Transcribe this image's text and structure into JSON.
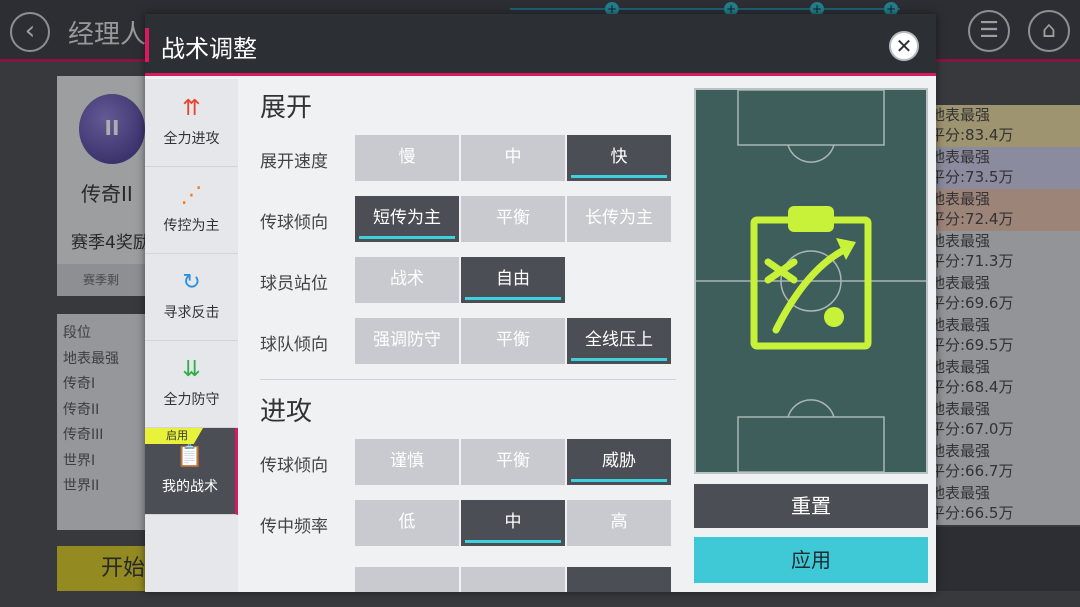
{
  "background": {
    "title": "经理人",
    "rank_name": "传奇II",
    "badge_text": "II",
    "season_text": "赛季4奖励",
    "remain_text": "赛季剩",
    "tier_header": "段位",
    "tiers": [
      "地表最强",
      "传奇I",
      "传奇II",
      "传奇III",
      "世界I",
      "世界II"
    ],
    "start_label": "开始",
    "leaderboard": [
      {
        "name": "地表最强",
        "score": "平分:83.4万",
        "color": "#e8d9a0"
      },
      {
        "name": "地表最强",
        "score": "平分:73.5万",
        "color": "#c9cbe6"
      },
      {
        "name": "地表最强",
        "score": "平分:72.4万",
        "color": "#e6c1ad"
      },
      {
        "name": "地表最强",
        "score": "平分:71.3万",
        "color": "#d8d9dc"
      },
      {
        "name": "地表最强",
        "score": "平分:69.6万",
        "color": "#d8d9dc"
      },
      {
        "name": "地表最强",
        "score": "平分:69.5万",
        "color": "#d8d9dc"
      },
      {
        "name": "地表最强",
        "score": "平分:68.4万",
        "color": "#d8d9dc"
      },
      {
        "name": "地表最强",
        "score": "平分:67.0万",
        "color": "#d8d9dc"
      },
      {
        "name": "地表最强",
        "score": "平分:66.7万",
        "color": "#d8d9dc"
      },
      {
        "name": "地表最强",
        "score": "平分:66.5万",
        "color": "#d8d9dc"
      }
    ]
  },
  "modal": {
    "title": "战术调整",
    "close_label": "✕",
    "tabs": [
      {
        "label": "全力进攻",
        "icon": "attack-icon",
        "glyph": "⇈",
        "color": "#e8442f"
      },
      {
        "label": "传控为主",
        "icon": "possession-icon",
        "glyph": "⋰",
        "color": "#ef7d22"
      },
      {
        "label": "寻求反击",
        "icon": "counter-icon",
        "glyph": "↻",
        "color": "#2a8fe0"
      },
      {
        "label": "全力防守",
        "icon": "defense-icon",
        "glyph": "⇊",
        "color": "#2fae4e"
      },
      {
        "label": "我的战术",
        "icon": "clipboard-icon",
        "glyph": "📋",
        "color": "#3fc9d6",
        "badge": "启用"
      }
    ],
    "sections": [
      {
        "title": "展开",
        "rows": [
          {
            "label": "展开速度",
            "options": [
              "慢",
              "中",
              "快"
            ],
            "selected": 2
          },
          {
            "label": "传球倾向",
            "options": [
              "短传为主",
              "平衡",
              "长传为主"
            ],
            "selected": 0
          },
          {
            "label": "球员站位",
            "options": [
              "战术",
              "自由"
            ],
            "selected": 1
          },
          {
            "label": "球队倾向",
            "options": [
              "强调防守",
              "平衡",
              "全线压上"
            ],
            "selected": 2
          }
        ]
      },
      {
        "title": "进攻",
        "rows": [
          {
            "label": "传球倾向",
            "options": [
              "谨慎",
              "平衡",
              "威胁"
            ],
            "selected": 2
          },
          {
            "label": "传中频率",
            "options": [
              "低",
              "中",
              "高"
            ],
            "selected": 1
          }
        ]
      }
    ],
    "reset_label": "重置",
    "apply_label": "应用",
    "accent": "#3ed0dc",
    "brand": "#d81b60",
    "tactic_icon_color": "#c8f23a"
  }
}
